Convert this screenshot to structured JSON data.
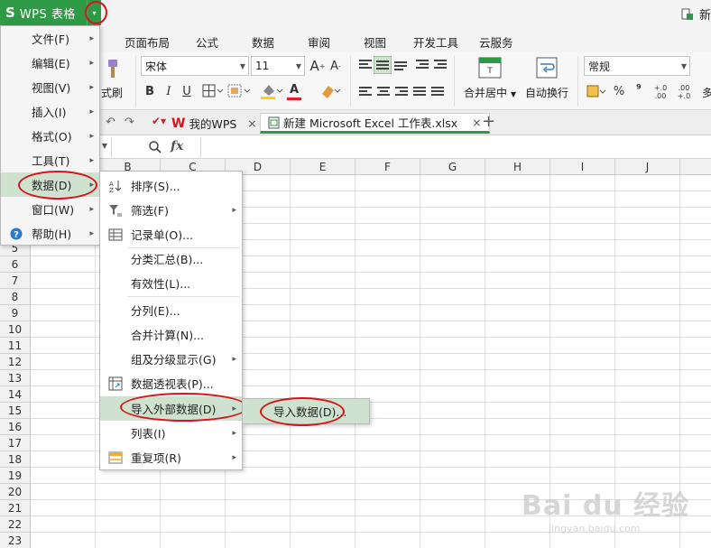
{
  "titlebar": {
    "logo": "S",
    "app_title": "WPS 表格",
    "drop_arrow": "▾",
    "right_text": "新"
  },
  "ribbon_tabs": [
    "页面布局",
    "公式",
    "数据",
    "审阅",
    "视图",
    "开发工具",
    "云服务"
  ],
  "ribbon": {
    "format_painter": "式刷",
    "font_name": "宋体",
    "font_size": "11",
    "grow_font": "A",
    "shrink_font": "A",
    "bold": "B",
    "italic": "I",
    "underline": "U",
    "font_color_letter": "A",
    "merge_center": "合并居中",
    "wrap_text": "自动换行",
    "number_format": "常规",
    "percent": "%",
    "comma": "⁹",
    "inc_decimal": "+.0 .00",
    "dec_decimal": ".00 +.0",
    "cut_text": "多"
  },
  "doc_tabs": {
    "my_wps": "我的WPS",
    "file_name": "新建 Microsoft Excel 工作表.xlsx",
    "close": "×",
    "add": "+"
  },
  "formula_bar": {
    "fx": "fx"
  },
  "columns": [
    "B",
    "C",
    "D",
    "E",
    "F",
    "G",
    "H",
    "I",
    "J"
  ],
  "rows": [
    "5",
    "6",
    "7",
    "8",
    "9",
    "10",
    "11",
    "12",
    "13",
    "14",
    "15",
    "16",
    "17",
    "18",
    "19",
    "20",
    "21",
    "22",
    "23"
  ],
  "main_menu": [
    {
      "label": "文件(F)",
      "submenu": "▸"
    },
    {
      "label": "编辑(E)",
      "submenu": "▸"
    },
    {
      "label": "视图(V)",
      "submenu": "▸"
    },
    {
      "label": "插入(I)",
      "submenu": "▸"
    },
    {
      "label": "格式(O)",
      "submenu": "▸"
    },
    {
      "label": "工具(T)",
      "submenu": "▸"
    },
    {
      "label": "数据(D)",
      "submenu": "▸"
    },
    {
      "label": "窗口(W)",
      "submenu": "▸"
    },
    {
      "label": "帮助(H)",
      "submenu": "▸"
    }
  ],
  "data_menu": [
    {
      "label": "排序(S)...",
      "submenu": ""
    },
    {
      "label": "筛选(F)",
      "submenu": "▸"
    },
    {
      "label": "记录单(O)...",
      "submenu": ""
    },
    {
      "label": "分类汇总(B)...",
      "submenu": ""
    },
    {
      "label": "有效性(L)...",
      "submenu": ""
    },
    {
      "label": "分列(E)...",
      "submenu": ""
    },
    {
      "label": "合并计算(N)...",
      "submenu": ""
    },
    {
      "label": "组及分级显示(G)",
      "submenu": "▸"
    },
    {
      "label": "数据透视表(P)...",
      "submenu": ""
    },
    {
      "label": "导入外部数据(D)",
      "submenu": "▸"
    },
    {
      "label": "列表(I)",
      "submenu": "▸"
    },
    {
      "label": "重复项(R)",
      "submenu": "▸"
    }
  ],
  "import_menu": {
    "label": "导入数据(D)..."
  },
  "watermark": {
    "brand": "Bai du 经验",
    "url": "jingyan.baidu.com"
  },
  "colors": {
    "wps_green": "#2f9a46",
    "menu_highlight": "#cfe2cf",
    "annotation_red": "#d6141b"
  }
}
